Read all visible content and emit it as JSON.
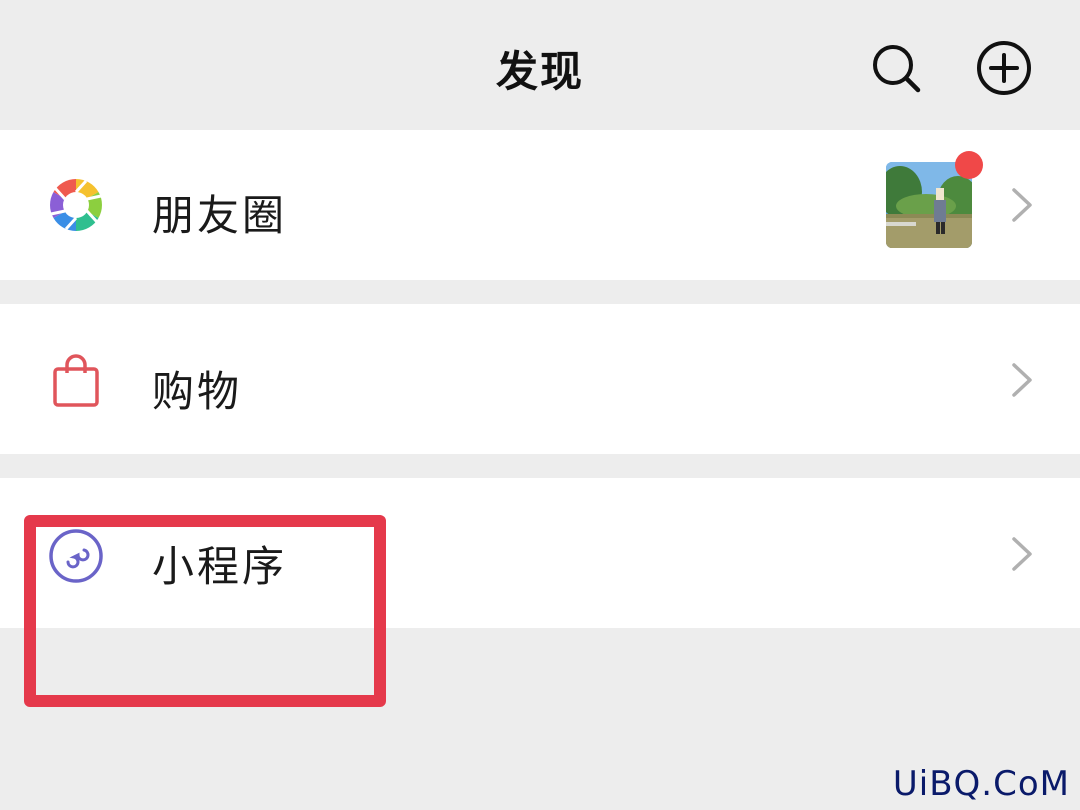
{
  "header": {
    "title": "发现",
    "search_icon": "search-icon",
    "add_icon": "plus-circle-icon"
  },
  "rows": {
    "moments": {
      "label": "朋友圈",
      "icon": "camera-aperture-icon",
      "has_badge": true,
      "has_thumbnail": true
    },
    "shopping": {
      "label": "购物",
      "icon": "shopping-bag-icon"
    },
    "miniprogram": {
      "label": "小程序",
      "icon": "mini-program-icon"
    }
  },
  "colors": {
    "background": "#ededed",
    "row_bg": "#ffffff",
    "badge": "#f04848",
    "highlight": "#e5394b",
    "shopping_icon": "#e0555b",
    "miniprogram_icon": "#6a64c8",
    "chevron": "#b0b0b0"
  },
  "watermark": "UiBQ.CoM"
}
